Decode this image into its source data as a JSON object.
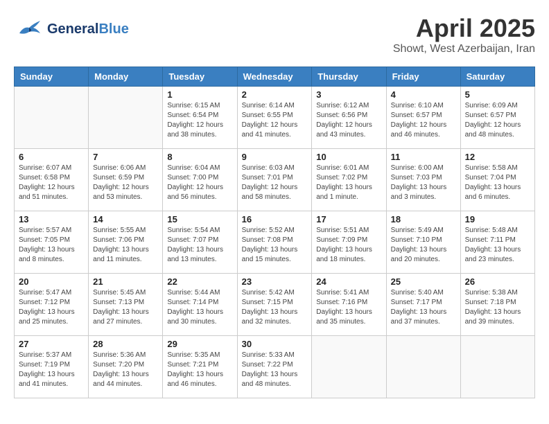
{
  "header": {
    "logo_general": "General",
    "logo_blue": "Blue",
    "title": "April 2025",
    "subtitle": "Showt, West Azerbaijan, Iran"
  },
  "calendar": {
    "days_of_week": [
      "Sunday",
      "Monday",
      "Tuesday",
      "Wednesday",
      "Thursday",
      "Friday",
      "Saturday"
    ],
    "weeks": [
      [
        {
          "day": "",
          "info": ""
        },
        {
          "day": "",
          "info": ""
        },
        {
          "day": "1",
          "info": "Sunrise: 6:15 AM\nSunset: 6:54 PM\nDaylight: 12 hours\nand 38 minutes."
        },
        {
          "day": "2",
          "info": "Sunrise: 6:14 AM\nSunset: 6:55 PM\nDaylight: 12 hours\nand 41 minutes."
        },
        {
          "day": "3",
          "info": "Sunrise: 6:12 AM\nSunset: 6:56 PM\nDaylight: 12 hours\nand 43 minutes."
        },
        {
          "day": "4",
          "info": "Sunrise: 6:10 AM\nSunset: 6:57 PM\nDaylight: 12 hours\nand 46 minutes."
        },
        {
          "day": "5",
          "info": "Sunrise: 6:09 AM\nSunset: 6:57 PM\nDaylight: 12 hours\nand 48 minutes."
        }
      ],
      [
        {
          "day": "6",
          "info": "Sunrise: 6:07 AM\nSunset: 6:58 PM\nDaylight: 12 hours\nand 51 minutes."
        },
        {
          "day": "7",
          "info": "Sunrise: 6:06 AM\nSunset: 6:59 PM\nDaylight: 12 hours\nand 53 minutes."
        },
        {
          "day": "8",
          "info": "Sunrise: 6:04 AM\nSunset: 7:00 PM\nDaylight: 12 hours\nand 56 minutes."
        },
        {
          "day": "9",
          "info": "Sunrise: 6:03 AM\nSunset: 7:01 PM\nDaylight: 12 hours\nand 58 minutes."
        },
        {
          "day": "10",
          "info": "Sunrise: 6:01 AM\nSunset: 7:02 PM\nDaylight: 13 hours\nand 1 minute."
        },
        {
          "day": "11",
          "info": "Sunrise: 6:00 AM\nSunset: 7:03 PM\nDaylight: 13 hours\nand 3 minutes."
        },
        {
          "day": "12",
          "info": "Sunrise: 5:58 AM\nSunset: 7:04 PM\nDaylight: 13 hours\nand 6 minutes."
        }
      ],
      [
        {
          "day": "13",
          "info": "Sunrise: 5:57 AM\nSunset: 7:05 PM\nDaylight: 13 hours\nand 8 minutes."
        },
        {
          "day": "14",
          "info": "Sunrise: 5:55 AM\nSunset: 7:06 PM\nDaylight: 13 hours\nand 11 minutes."
        },
        {
          "day": "15",
          "info": "Sunrise: 5:54 AM\nSunset: 7:07 PM\nDaylight: 13 hours\nand 13 minutes."
        },
        {
          "day": "16",
          "info": "Sunrise: 5:52 AM\nSunset: 7:08 PM\nDaylight: 13 hours\nand 15 minutes."
        },
        {
          "day": "17",
          "info": "Sunrise: 5:51 AM\nSunset: 7:09 PM\nDaylight: 13 hours\nand 18 minutes."
        },
        {
          "day": "18",
          "info": "Sunrise: 5:49 AM\nSunset: 7:10 PM\nDaylight: 13 hours\nand 20 minutes."
        },
        {
          "day": "19",
          "info": "Sunrise: 5:48 AM\nSunset: 7:11 PM\nDaylight: 13 hours\nand 23 minutes."
        }
      ],
      [
        {
          "day": "20",
          "info": "Sunrise: 5:47 AM\nSunset: 7:12 PM\nDaylight: 13 hours\nand 25 minutes."
        },
        {
          "day": "21",
          "info": "Sunrise: 5:45 AM\nSunset: 7:13 PM\nDaylight: 13 hours\nand 27 minutes."
        },
        {
          "day": "22",
          "info": "Sunrise: 5:44 AM\nSunset: 7:14 PM\nDaylight: 13 hours\nand 30 minutes."
        },
        {
          "day": "23",
          "info": "Sunrise: 5:42 AM\nSunset: 7:15 PM\nDaylight: 13 hours\nand 32 minutes."
        },
        {
          "day": "24",
          "info": "Sunrise: 5:41 AM\nSunset: 7:16 PM\nDaylight: 13 hours\nand 35 minutes."
        },
        {
          "day": "25",
          "info": "Sunrise: 5:40 AM\nSunset: 7:17 PM\nDaylight: 13 hours\nand 37 minutes."
        },
        {
          "day": "26",
          "info": "Sunrise: 5:38 AM\nSunset: 7:18 PM\nDaylight: 13 hours\nand 39 minutes."
        }
      ],
      [
        {
          "day": "27",
          "info": "Sunrise: 5:37 AM\nSunset: 7:19 PM\nDaylight: 13 hours\nand 41 minutes."
        },
        {
          "day": "28",
          "info": "Sunrise: 5:36 AM\nSunset: 7:20 PM\nDaylight: 13 hours\nand 44 minutes."
        },
        {
          "day": "29",
          "info": "Sunrise: 5:35 AM\nSunset: 7:21 PM\nDaylight: 13 hours\nand 46 minutes."
        },
        {
          "day": "30",
          "info": "Sunrise: 5:33 AM\nSunset: 7:22 PM\nDaylight: 13 hours\nand 48 minutes."
        },
        {
          "day": "",
          "info": ""
        },
        {
          "day": "",
          "info": ""
        },
        {
          "day": "",
          "info": ""
        }
      ]
    ]
  }
}
